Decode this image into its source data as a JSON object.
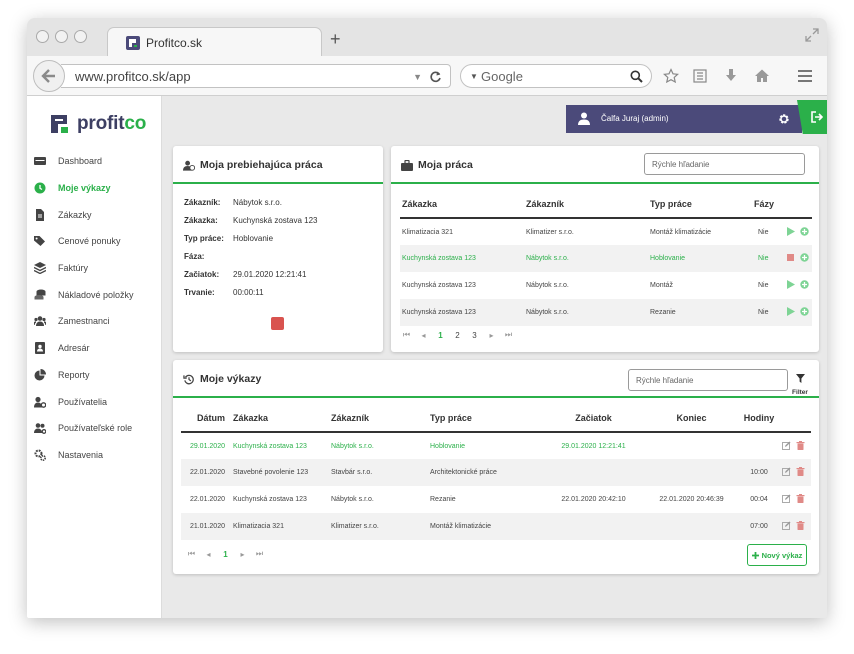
{
  "browser": {
    "tab_title": "Profitco.sk",
    "new_tab": "+",
    "url": "www.profitco.sk/app",
    "search_engine": "Google"
  },
  "app": {
    "logo_text": "profitco",
    "logo_highlight": "co",
    "logo_main": "profit",
    "user_name": "Čalfa Juraj (admin)",
    "accent": "#2bb04a",
    "brand_dark": "#4b4a7a"
  },
  "sidebar": {
    "items": [
      {
        "label": "Dashboard",
        "icon": "dashboard-icon"
      },
      {
        "label": "Moje výkazy",
        "icon": "clock-icon",
        "active": true
      },
      {
        "label": "Zákazky",
        "icon": "file-icon"
      },
      {
        "label": "Cenové ponuky",
        "icon": "tags-icon"
      },
      {
        "label": "Faktúry",
        "icon": "layers-icon"
      },
      {
        "label": "Nákladové položky",
        "icon": "coins-icon"
      },
      {
        "label": "Zamestnanci",
        "icon": "users-icon"
      },
      {
        "label": "Adresár",
        "icon": "address-book-icon"
      },
      {
        "label": "Reporty",
        "icon": "pie-chart-icon"
      },
      {
        "label": "Používatelia",
        "icon": "user-gear-icon"
      },
      {
        "label": "Používateľské role",
        "icon": "users-gear-icon"
      },
      {
        "label": "Nastavenia",
        "icon": "cogs-icon"
      }
    ]
  },
  "current_work": {
    "title": "Moja prebiehajúca práca",
    "fields": [
      {
        "key": "Zákazník:",
        "value": "Nábytok s.r.o."
      },
      {
        "key": "Zákazka:",
        "value": "Kuchynská zostava 123"
      },
      {
        "key": "Typ práce:",
        "value": "Hoblovanie"
      },
      {
        "key": "Fáza:",
        "value": ""
      },
      {
        "key": "Začiatok:",
        "value": "29.01.2020 12:21:41"
      },
      {
        "key": "Trvanie:",
        "value": "00:00:11"
      }
    ]
  },
  "my_work": {
    "title": "Moja práca",
    "search_placeholder": "Rýchle hľadanie",
    "columns": [
      "Zákazka",
      "Zákazník",
      "Typ práce",
      "Fázy"
    ],
    "rows": [
      {
        "zakazka": "Klimatizacia 321",
        "zakaznik": "Klimatizer s.r.o.",
        "typ": "Montáž klimatizácie",
        "fazy": "Nie"
      },
      {
        "zakazka": "Kuchynská zostava 123",
        "zakaznik": "Nábytok s.r.o.",
        "typ": "Hoblovanie",
        "fazy": "Nie",
        "running": true
      },
      {
        "zakazka": "Kuchynská zostava 123",
        "zakaznik": "Nábytok s.r.o.",
        "typ": "Montáž",
        "fazy": "Nie"
      },
      {
        "zakazka": "Kuchynská zostava 123",
        "zakaznik": "Nábytok s.r.o.",
        "typ": "Rezanie",
        "fazy": "Nie"
      }
    ],
    "pager": {
      "first": "⏮",
      "prev": "◂",
      "pages": [
        "1",
        "2",
        "3"
      ],
      "current": "1",
      "next": "▸",
      "last": "⏭"
    }
  },
  "reports": {
    "title": "Moje výkazy",
    "search_placeholder": "Rýchle hľadanie",
    "filter_label": "Filter",
    "columns": [
      "Dátum",
      "Zákazka",
      "Zákazník",
      "Typ práce",
      "Začiatok",
      "Koniec",
      "Hodiny"
    ],
    "rows": [
      {
        "datum": "29.01.2020",
        "zakazka": "Kuchynská zostava 123",
        "zakaznik": "Nábytok s.r.o.",
        "typ": "Hoblovanie",
        "zaciatok": "29.01.2020 12:21:41",
        "koniec": "",
        "hodiny": "",
        "running": true
      },
      {
        "datum": "22.01.2020",
        "zakazka": "Stavebné povolenie 123",
        "zakaznik": "Stavbár s.r.o.",
        "typ": "Architektonické práce",
        "zaciatok": "",
        "koniec": "",
        "hodiny": "10:00"
      },
      {
        "datum": "22.01.2020",
        "zakazka": "Kuchynská zostava 123",
        "zakaznik": "Nábytok s.r.o.",
        "typ": "Rezanie",
        "zaciatok": "22.01.2020 20:42:10",
        "koniec": "22.01.2020 20:46:39",
        "hodiny": "00:04"
      },
      {
        "datum": "21.01.2020",
        "zakazka": "Klimatizacia 321",
        "zakaznik": "Klimatizer s.r.o.",
        "typ": "Montáž klimatizácie",
        "zaciatok": "",
        "koniec": "",
        "hodiny": "07:00"
      }
    ],
    "pager": {
      "first": "⏮",
      "prev": "◂",
      "pages": [
        "1"
      ],
      "current": "1",
      "next": "▸",
      "last": "⏭"
    },
    "new_button": "Nový výkaz"
  }
}
